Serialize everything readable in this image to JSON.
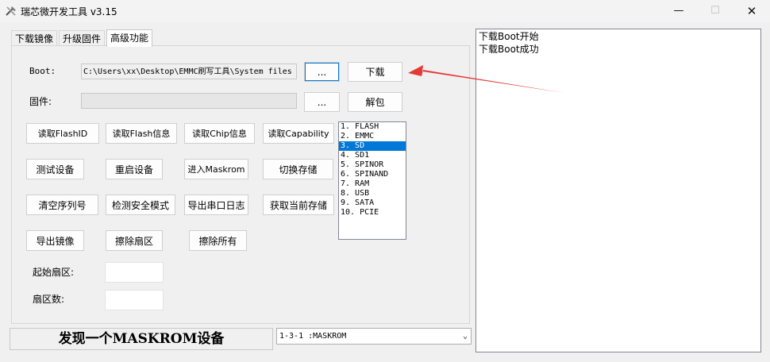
{
  "window": {
    "title": "瑞芯微开发工具 v3.15",
    "controls": {
      "minimize": "—",
      "maximize": "☐",
      "close": "✕"
    }
  },
  "tabs": [
    {
      "label": "下载镜像",
      "active": false
    },
    {
      "label": "升级固件",
      "active": false
    },
    {
      "label": "高级功能",
      "active": true
    }
  ],
  "boot": {
    "label": "Boot:",
    "path": "C:\\Users\\xx\\Desktop\\EMMC刷写工具\\System files",
    "browse_label": "...",
    "download_label": "下载"
  },
  "firmware": {
    "label": "固件:",
    "path": "",
    "browse_label": "...",
    "unpack_label": "解包"
  },
  "actions": {
    "read_flash_id": "读取FlashID",
    "read_flash_info": "读取Flash信息",
    "read_chip_info": "读取Chip信息",
    "read_capability": "读取Capability",
    "test_device": "测试设备",
    "reset_device": "重启设备",
    "enter_maskrom": "进入Maskrom",
    "switch_storage": "切换存储",
    "clear_serial": "清空序列号",
    "check_secure_mode": "检测安全模式",
    "export_serial_log": "导出串口日志",
    "get_current_storage": "获取当前存储",
    "export_image": "导出镜像",
    "erase_sectors": "擦除扇区",
    "erase_all": "擦除所有"
  },
  "storage_list": {
    "items": [
      "1.  FLASH",
      "2.  EMMC",
      "3.  SD",
      "4.  SD1",
      "5.  SPINOR",
      "6.  SPINAND",
      "7.  RAM",
      "8.  USB",
      "9.  SATA",
      "10.  PCIE"
    ],
    "selected_index": 2
  },
  "sectors": {
    "start_label": "起始扇区:",
    "start_value": "",
    "count_label": "扇区数:",
    "count_value": ""
  },
  "status": {
    "text": "发现一个MASKROM设备",
    "device": "1-3-1 :MASKROM"
  },
  "log": {
    "lines": [
      "下载Boot开始",
      "下载Boot成功"
    ]
  },
  "annotation_color": "#e53935",
  "accent_color": "#0078d7"
}
